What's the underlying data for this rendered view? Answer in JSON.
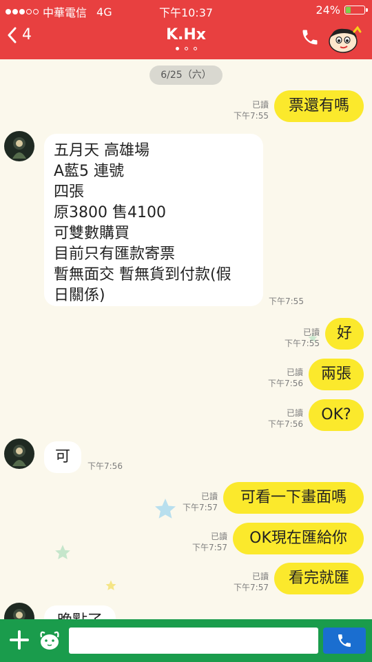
{
  "status": {
    "carrier": "中華電信",
    "network": "4G",
    "time": "下午10:37",
    "battery": "24%",
    "battery_level": 0.24
  },
  "header": {
    "back_count": "4",
    "title": "K.Hx"
  },
  "chat": {
    "date": "6/25（六）",
    "messages": [
      {
        "dir": "out",
        "text": "票還有嗎",
        "read": "已讀",
        "time": "下午7:55"
      },
      {
        "dir": "in",
        "lines": [
          "五月天 高雄場",
          "A藍5 連號",
          "四張",
          "原3800 售4100",
          "可雙數購買",
          "目前只有匯款寄票",
          "暫無面交 暫無貨到付款(假",
          "日關係)"
        ],
        "time": "下午7:55"
      },
      {
        "dir": "out",
        "text": "好",
        "read": "已讀",
        "time": "下午7:55"
      },
      {
        "dir": "out",
        "text": "兩張",
        "read": "已讀",
        "time": "下午7:56"
      },
      {
        "dir": "out",
        "text": "OK?",
        "read": "已讀",
        "time": "下午7:56"
      },
      {
        "dir": "in",
        "text": "可",
        "time": "下午7:56"
      },
      {
        "dir": "out",
        "text": "可看一下畫面嗎",
        "read": "已讀",
        "time": "下午7:57"
      },
      {
        "dir": "out",
        "text": "OK現在匯給你",
        "read": "已讀",
        "time": "下午7:57"
      },
      {
        "dir": "out",
        "text": "看完就匯",
        "read": "已讀",
        "time": "下午7:57"
      },
      {
        "dir": "in",
        "text": "晚點了",
        "time": ""
      }
    ]
  },
  "input": {
    "placeholder": ""
  },
  "colors": {
    "header": "#e84040",
    "out_bubble": "#fbe92c",
    "in_bubble": "#ffffff",
    "background": "#fbf8ec",
    "bottom_bar": "#1a9c4c",
    "call_button": "#1a6ed0"
  },
  "icons": {
    "back": "chevron-left-icon",
    "phone": "phone-icon",
    "plus": "plus-icon",
    "sticker": "sticker-icon",
    "call": "call-icon"
  }
}
